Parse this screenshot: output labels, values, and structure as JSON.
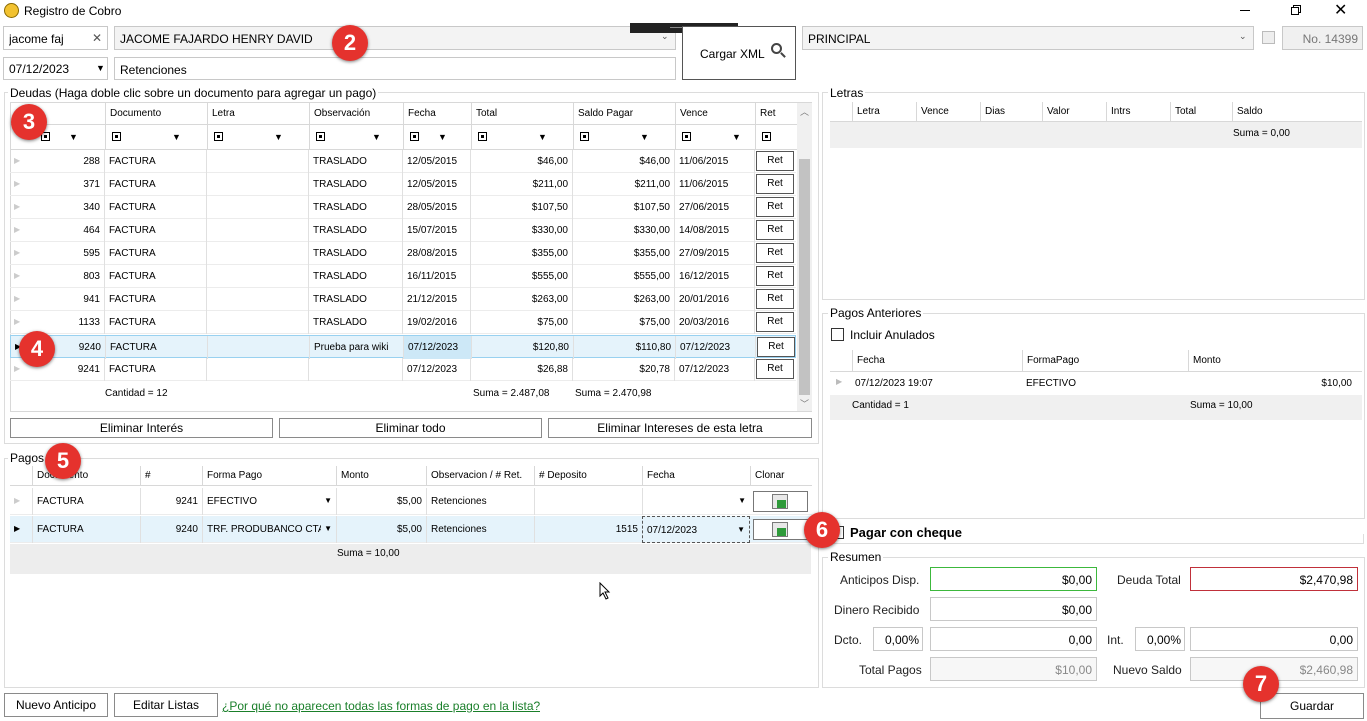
{
  "window": {
    "title": "Registro de Cobro"
  },
  "top": {
    "search_value": "jacome faj",
    "client_name": "JACOME FAJARDO HENRY DAVID",
    "date": "07/12/2023",
    "concept": "Retenciones",
    "cargar_xml": "Cargar XML",
    "branch": "PRINCIPAL",
    "number": "No. 14399"
  },
  "deudas": {
    "title": "Deudas (Haga doble clic sobre un documento para agregar un pago)",
    "columns": [
      "Documento",
      "Letra",
      "Observación",
      "Fecha",
      "Total",
      "Saldo Pagar",
      "Vence",
      "Ret"
    ],
    "rows": [
      {
        "num": "288",
        "doc": "FACTURA",
        "letra": "",
        "obs": "TRASLADO",
        "fecha": "12/05/2015",
        "total": "$46,00",
        "saldo": "$46,00",
        "vence": "11/06/2015",
        "ret": "Ret"
      },
      {
        "num": "371",
        "doc": "FACTURA",
        "letra": "",
        "obs": "TRASLADO",
        "fecha": "12/05/2015",
        "total": "$211,00",
        "saldo": "$211,00",
        "vence": "11/06/2015",
        "ret": "Ret"
      },
      {
        "num": "340",
        "doc": "FACTURA",
        "letra": "",
        "obs": "TRASLADO",
        "fecha": "28/05/2015",
        "total": "$107,50",
        "saldo": "$107,50",
        "vence": "27/06/2015",
        "ret": "Ret"
      },
      {
        "num": "464",
        "doc": "FACTURA",
        "letra": "",
        "obs": "TRASLADO",
        "fecha": "15/07/2015",
        "total": "$330,00",
        "saldo": "$330,00",
        "vence": "14/08/2015",
        "ret": "Ret"
      },
      {
        "num": "595",
        "doc": "FACTURA",
        "letra": "",
        "obs": "TRASLADO",
        "fecha": "28/08/2015",
        "total": "$355,00",
        "saldo": "$355,00",
        "vence": "27/09/2015",
        "ret": "Ret"
      },
      {
        "num": "803",
        "doc": "FACTURA",
        "letra": "",
        "obs": "TRASLADO",
        "fecha": "16/11/2015",
        "total": "$555,00",
        "saldo": "$555,00",
        "vence": "16/12/2015",
        "ret": "Ret"
      },
      {
        "num": "941",
        "doc": "FACTURA",
        "letra": "",
        "obs": "TRASLADO",
        "fecha": "21/12/2015",
        "total": "$263,00",
        "saldo": "$263,00",
        "vence": "20/01/2016",
        "ret": "Ret"
      },
      {
        "num": "1133",
        "doc": "FACTURA",
        "letra": "",
        "obs": "TRASLADO",
        "fecha": "19/02/2016",
        "total": "$75,00",
        "saldo": "$75,00",
        "vence": "20/03/2016",
        "ret": "Ret"
      },
      {
        "num": "9240",
        "doc": "FACTURA",
        "letra": "",
        "obs": "Prueba para wiki",
        "fecha": "07/12/2023",
        "total": "$120,80",
        "saldo": "$110,80",
        "vence": "07/12/2023",
        "ret": "Ret"
      },
      {
        "num": "9241",
        "doc": "FACTURA",
        "letra": "",
        "obs": "",
        "fecha": "07/12/2023",
        "total": "$26,88",
        "saldo": "$20,78",
        "vence": "07/12/2023",
        "ret": "Ret"
      }
    ],
    "cantidad": "Cantidad = 12",
    "suma_total": "Suma = 2.487,08",
    "suma_saldo": "Suma = 2.470,98",
    "btn_eliminar_interes": "Eliminar Interés",
    "btn_eliminar_todo": "Eliminar todo",
    "btn_eliminar_intereses_letra": "Eliminar Intereses de esta letra"
  },
  "pagos": {
    "title": "Pagos",
    "columns": [
      "Documento",
      "#",
      "Forma Pago",
      "Monto",
      "Observacion / # Ret.",
      "# Deposito",
      "Fecha",
      "Clonar"
    ],
    "rows": [
      {
        "doc": "FACTURA",
        "num": "9241",
        "forma": "EFECTIVO",
        "monto": "$5,00",
        "obs": "Retenciones",
        "deposito": "",
        "fecha": ""
      },
      {
        "doc": "FACTURA",
        "num": "9240",
        "forma": "TRF. PRODUBANCO CTA C",
        "monto": "$5,00",
        "obs": "Retenciones",
        "deposito": "1515",
        "fecha": "07/12/2023"
      }
    ],
    "suma": "Suma = 10,00"
  },
  "letras": {
    "title": "Letras",
    "columns": [
      "Letra",
      "Vence",
      "Dias",
      "Valor",
      "Intrs",
      "Total",
      "Saldo"
    ],
    "suma": "Suma = 0,00"
  },
  "pagos_anteriores": {
    "title": "Pagos Anteriores",
    "incluir_anulados": "Incluir Anulados",
    "columns": [
      "Fecha",
      "FormaPago",
      "Monto"
    ],
    "rows": [
      {
        "fecha": "07/12/2023 19:07",
        "forma": "EFECTIVO",
        "monto": "$10,00"
      }
    ],
    "cantidad": "Cantidad = 1",
    "suma": "Suma = 10,00"
  },
  "cheque": {
    "label": "Pagar con cheque"
  },
  "resumen": {
    "title": "Resumen",
    "anticipos_label": "Anticipos Disp.",
    "anticipos_value": "$0,00",
    "deuda_total_label": "Deuda Total",
    "deuda_total_value": "$2,470,98",
    "dinero_recibido_label": "Dinero Recibido",
    "dinero_recibido_value": "$0,00",
    "dcto_label": "Dcto.",
    "dcto_pct": "0,00%",
    "dcto_value": "0,00",
    "int_label": "Int.",
    "int_pct": "0,00%",
    "int_value": "0,00",
    "total_pagos_label": "Total Pagos",
    "total_pagos_value": "$10,00",
    "nuevo_saldo_label": "Nuevo Saldo",
    "nuevo_saldo_value": "$2,460,98"
  },
  "footer": {
    "nuevo_anticipo": "Nuevo Anticipo",
    "editar_listas": "Editar Listas",
    "help_link": "¿Por qué no aparecen todas las formas de pago en la lista?",
    "guardar": "Guardar"
  },
  "badges": [
    "2",
    "3",
    "4",
    "5",
    "6",
    "7"
  ],
  "colors": {
    "highlight_row": "#e5f3fb",
    "badge": "#e5322d",
    "green_border": "#3cb83c",
    "red_border": "#c0303a",
    "link": "#1a7f2a"
  }
}
